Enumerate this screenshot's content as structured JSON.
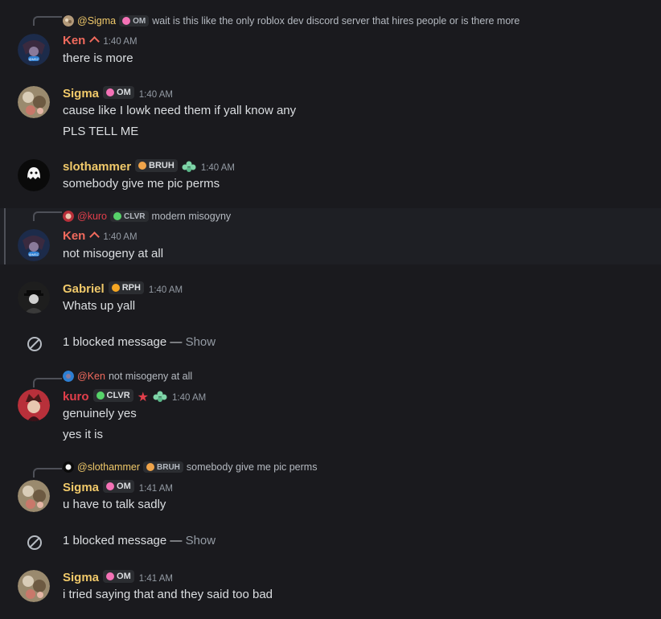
{
  "colors": {
    "ken": "#f06a5d",
    "sigma": "#f0c96a",
    "slothammer": "#f0c96a",
    "gabriel": "#f0c96a",
    "kuro": "#e23f4b"
  },
  "messages": [
    {
      "reply": {
        "name": "@Sigma",
        "tag": "OM",
        "text": "wait is this like the only roblox dev discord server that hires people or is there more"
      },
      "name": "Ken",
      "time": "1:40 AM",
      "lines": [
        "there is more"
      ]
    },
    {
      "name": "Sigma",
      "tag": "OM",
      "time": "1:40 AM",
      "lines": [
        "cause like I lowk need them if yall know any",
        "PLS TELL ME"
      ]
    },
    {
      "name": "slothammer",
      "tag": "BRUH",
      "time": "1:40 AM",
      "lines": [
        "somebody give me pic perms"
      ]
    },
    {
      "reply": {
        "name": "@kuro",
        "tag": "CLVR",
        "text": "modern misogyny"
      },
      "name": "Ken",
      "time": "1:40 AM",
      "lines": [
        "not misogeny at all"
      ]
    },
    {
      "name": "Gabriel",
      "tag": "RPH",
      "time": "1:40 AM",
      "lines": [
        "Whats up yall"
      ]
    },
    {
      "reply": {
        "name": "@Ken",
        "text": "not misogeny at all"
      },
      "name": "kuro",
      "tag": "CLVR",
      "time": "1:40 AM",
      "lines": [
        "genuinely yes",
        "yes it is"
      ]
    },
    {
      "reply": {
        "name": "@slothammer",
        "tag": "BRUH",
        "text": "somebody give me pic perms"
      },
      "name": "Sigma",
      "tag": "OM",
      "time": "1:41 AM",
      "lines": [
        "u have to talk sadly"
      ]
    },
    {
      "name": "Sigma",
      "tag": "OM",
      "time": "1:41 AM",
      "lines": [
        "i tried saying that and they said too bad"
      ]
    }
  ],
  "blocked": [
    {
      "text": "1 blocked message — ",
      "show": "Show"
    },
    {
      "text": "1 blocked message — ",
      "show": "Show"
    }
  ]
}
